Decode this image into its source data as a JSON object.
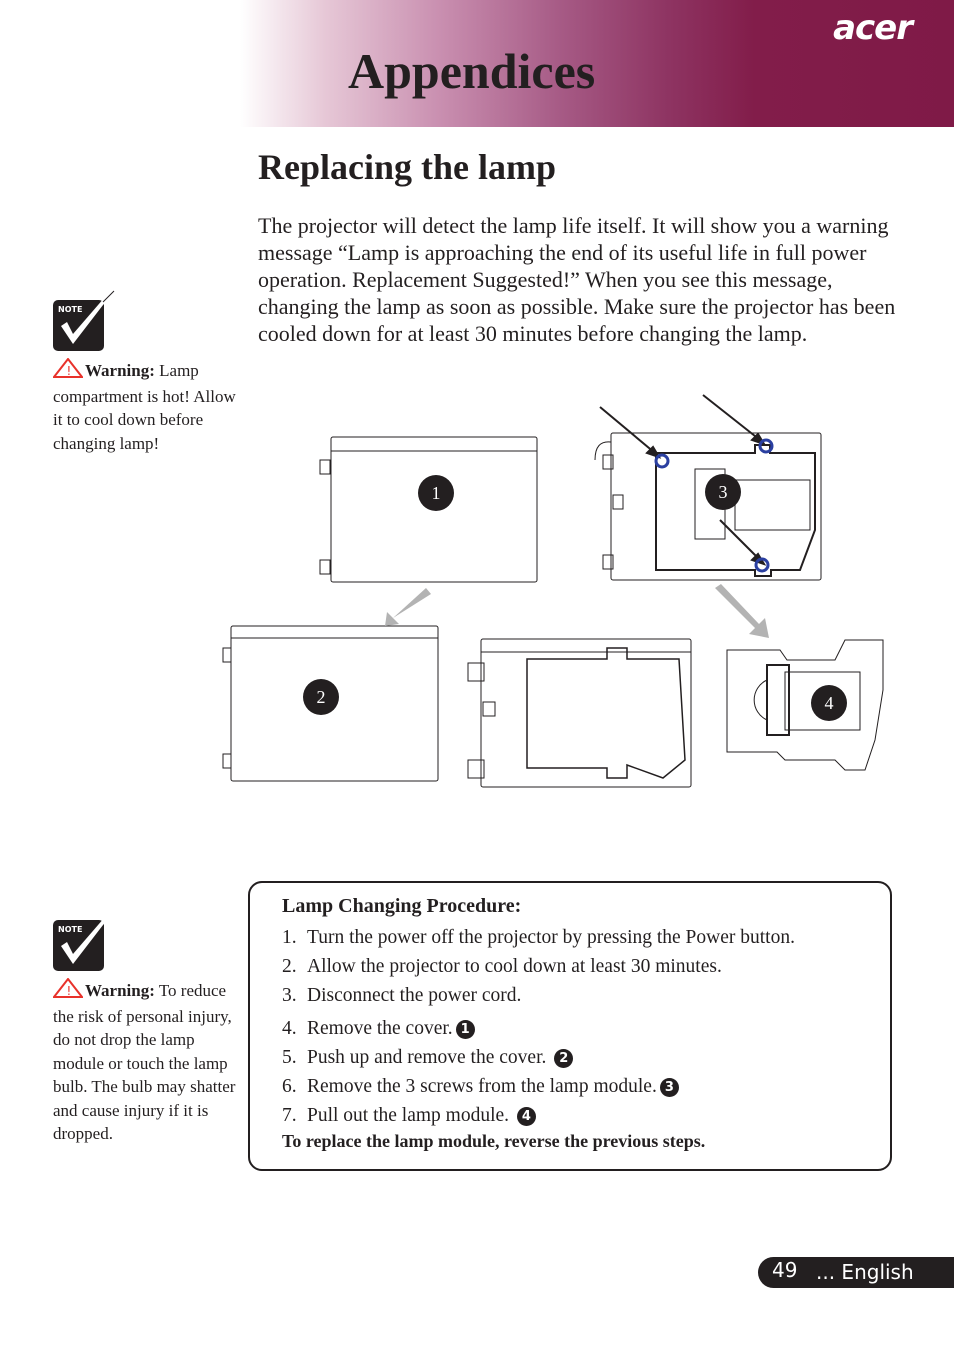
{
  "header": {
    "brand": "acer",
    "title": "Appendices",
    "colors": {
      "band_start": "#ffffff",
      "band_end": "#7f1a47"
    }
  },
  "section": {
    "title": "Replacing the lamp",
    "intro": "The projector will detect the lamp life itself. It will show you a warning message “Lamp is approaching the end of its useful life in full power operation. Replacement Suggested!” When you see this message, changing the lamp as soon as possible. Make sure the projector has been cooled down for at least 30 minutes before changing the lamp."
  },
  "notes": [
    {
      "icon": "note-check-icon",
      "icon_label": "Note",
      "warning_label": "Warning:",
      "text": " Lamp compartment is hot! Allow it to cool down before changing lamp!"
    },
    {
      "icon": "note-check-icon",
      "icon_label": "Note",
      "warning_label": "Warning:",
      "text": " To reduce the risk of personal injury, do not drop the lamp module or touch the lamp bulb. The bulb may shatter and cause injury if it is dropped."
    }
  ],
  "diagram": {
    "step_badges": [
      "1",
      "2",
      "3",
      "4"
    ],
    "screw_color": "#2a3fa0",
    "arrow_color": "#b3b3b3"
  },
  "procedure": {
    "title": "Lamp Changing Procedure:",
    "steps": [
      {
        "num": "1.",
        "text": "Turn the power off the projector by pressing the Power button.",
        "badge": ""
      },
      {
        "num": "2.",
        "text": "Allow the projector to cool down at least 30 minutes.",
        "badge": ""
      },
      {
        "num": "3.",
        "text": "Disconnect the power cord.",
        "badge": ""
      },
      {
        "num": "4.",
        "text": "Remove the cover.",
        "badge": "1"
      },
      {
        "num": "5.",
        "text": "Push up and remove the cover. ",
        "badge": "2"
      },
      {
        "num": "6.",
        "text": "Remove the 3 screws from the lamp module.",
        "badge": "3"
      },
      {
        "num": "7.",
        "text": "Pull out the lamp module. ",
        "badge": "4"
      }
    ],
    "footer": "To replace the lamp module, reverse the previous steps."
  },
  "footer": {
    "page_number": "49",
    "language": "... English"
  }
}
